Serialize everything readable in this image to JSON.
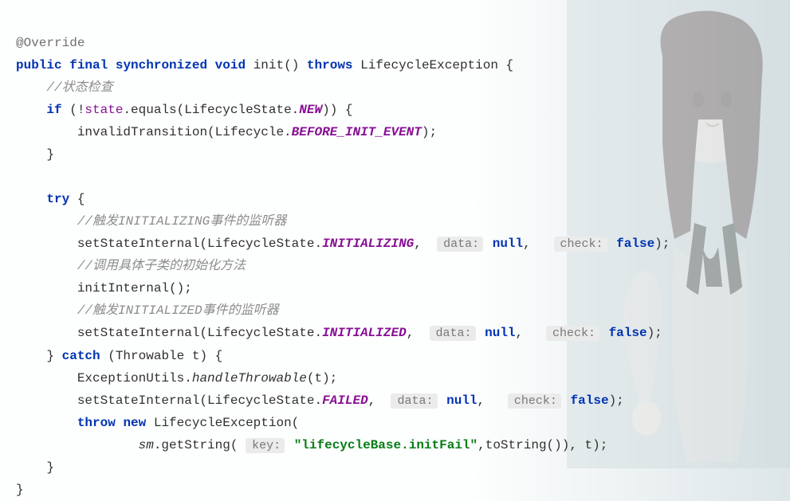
{
  "code": {
    "annotation": "@Override",
    "line2": {
      "kw1": "public",
      "kw2": "final",
      "kw3": "synchronized",
      "kw4": "void",
      "method": "init",
      "paren": "()",
      "kw5": "throws",
      "exc": "LifecycleException {"
    },
    "comment1": "//状态检查",
    "line4": {
      "kw": "if",
      "pre": "(!",
      "field": "state",
      "mid": ".equals(LifecycleState.",
      "const": "NEW",
      "post": ")) {"
    },
    "line5": {
      "text1": "invalidTransition(Lifecycle.",
      "const": "BEFORE_INIT_EVENT",
      "text2": ");"
    },
    "close1": "}",
    "line8": {
      "kw": "try",
      "brace": " {"
    },
    "comment2": "//触发INITIALIZING事件的监听器",
    "line10": {
      "text1": "setStateInternal(LifecycleState.",
      "const": "INITIALIZING",
      "comma1": ", ",
      "hint1": "data:",
      "null1": "null",
      "comma2": ", ",
      "hint2": "check:",
      "bool1": "false",
      "end": ");"
    },
    "comment3": "//调用具体子类的初始化方法",
    "line12": "initInternal();",
    "comment4": "//触发INITIALIZED事件的监听器",
    "line14": {
      "text1": "setStateInternal(LifecycleState.",
      "const": "INITIALIZED",
      "comma1": ", ",
      "hint1": "data:",
      "null1": "null",
      "comma2": ", ",
      "hint2": "check:",
      "bool1": "false",
      "end": ");"
    },
    "line15": {
      "close": "} ",
      "kw": "catch",
      "text": " (Throwable t) {"
    },
    "line16": {
      "text1": "ExceptionUtils.",
      "method": "handleThrowable",
      "text2": "(t);"
    },
    "line17": {
      "text1": "setStateInternal(LifecycleState.",
      "const": "FAILED",
      "comma1": ", ",
      "hint1": "data:",
      "null1": "null",
      "comma2": ", ",
      "hint2": "check:",
      "bool1": "false",
      "end": ");"
    },
    "line18": {
      "kw1": "throw",
      "kw2": "new",
      "text": " LifecycleException("
    },
    "line19": {
      "sm": "sm",
      "text1": ".getString(",
      "hint": "key:",
      "str": "\"lifecycleBase.initFail\"",
      "text2": ",toString()), t);"
    },
    "close2": "}",
    "close3": "}"
  }
}
